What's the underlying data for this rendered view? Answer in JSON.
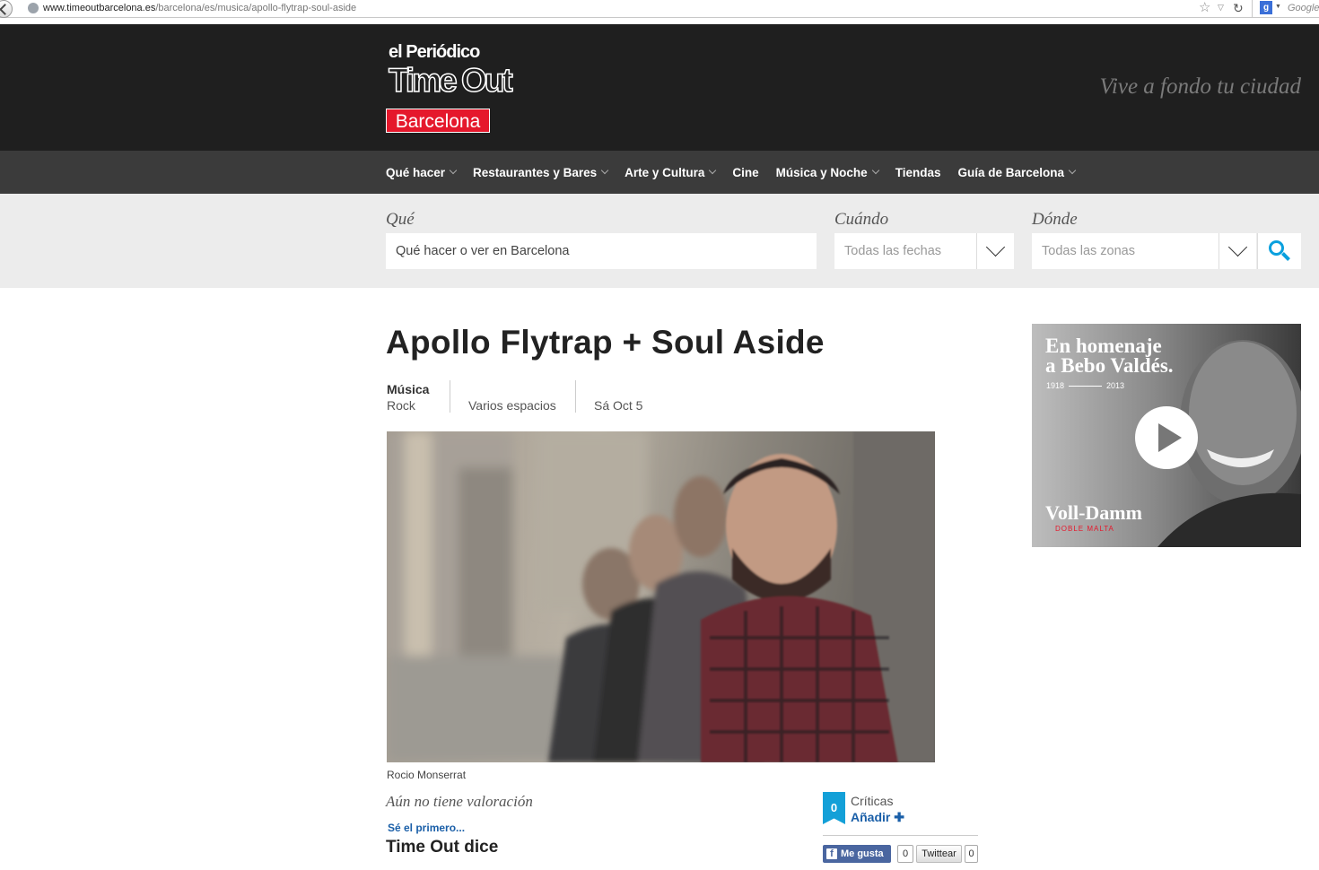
{
  "browser": {
    "url_domain": "www.timeoutbarcelona.es",
    "url_path": "/barcelona/es/musica/apollo-flytrap-soul-aside",
    "search_placeholder": "Google"
  },
  "header": {
    "logo_top": "el Periódico",
    "logo_mid": "Time Out",
    "logo_bottom": "Barcelona",
    "tagline": "Vive a fondo tu ciudad"
  },
  "nav": {
    "items": [
      {
        "label": "Qué hacer",
        "has_menu": true
      },
      {
        "label": "Restaurantes y Bares",
        "has_menu": true
      },
      {
        "label": "Arte y Cultura",
        "has_menu": true
      },
      {
        "label": "Cine",
        "has_menu": false
      },
      {
        "label": "Música y Noche",
        "has_menu": true
      },
      {
        "label": "Tiendas",
        "has_menu": false
      },
      {
        "label": "Guía de Barcelona",
        "has_menu": true
      }
    ]
  },
  "search": {
    "what_label": "Qué",
    "what_value": "Qué hacer o ver en Barcelona",
    "when_label": "Cuándo",
    "when_value": "Todas las fechas",
    "where_label": "Dónde",
    "where_value": "Todas las zonas"
  },
  "event": {
    "title": "Apollo Flytrap + Soul Aside",
    "category": "Música",
    "subcategory": "Rock",
    "venue": "Varios espacios",
    "date": "Sá Oct 5",
    "photo_credit": "Rocio Monserrat"
  },
  "rating": {
    "text": "Aún no tiene valoración",
    "first_link": "Sé el primero...",
    "section_title": "Time Out dice"
  },
  "reviews": {
    "count": "0",
    "label": "Críticas",
    "add_label": "Añadir ✚"
  },
  "social": {
    "fb_label": "Me gusta",
    "fb_count": "0",
    "tw_label": "Twittear",
    "tw_count": "0"
  },
  "ad": {
    "headline_1": "En homenaje",
    "headline_2": "a Bebo Valdés.",
    "year_start": "1918",
    "year_end": "2013",
    "brand": "Voll-Damm",
    "brand_sub": "DOBLE MALTA"
  },
  "colors": {
    "header_bg": "#1f1f1f",
    "nav_bg": "#3b3b3b",
    "brand_red": "#e5182c",
    "accent_blue": "#13a0d8",
    "link_blue": "#1a5fa8"
  }
}
